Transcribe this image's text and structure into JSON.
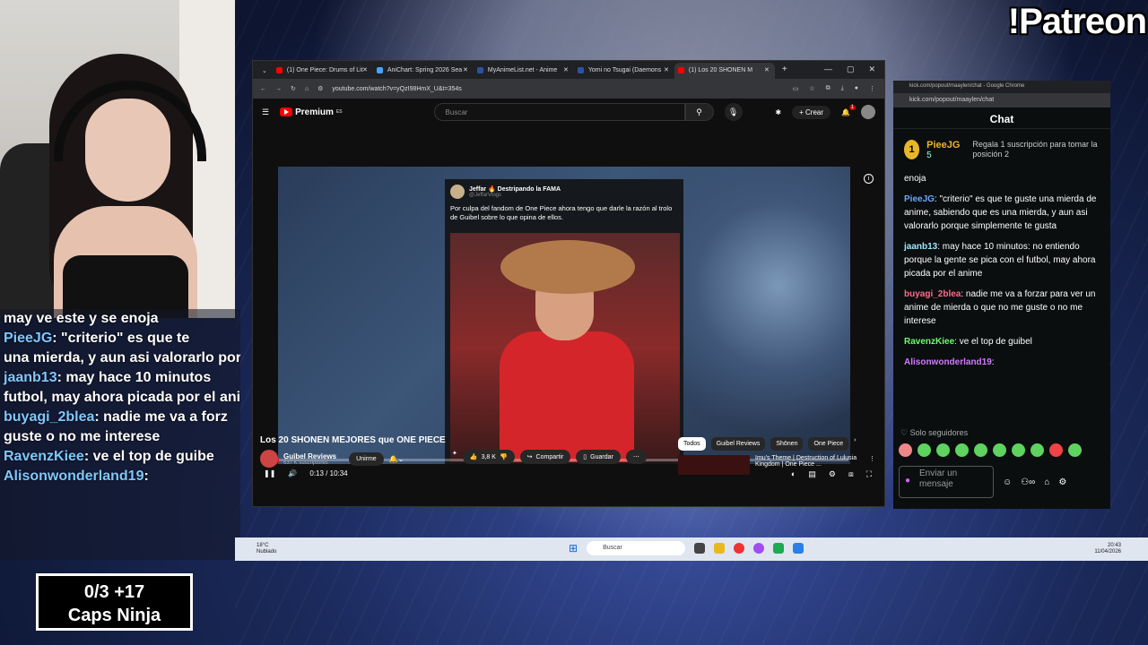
{
  "overlay": {
    "patreon": "!Patreon",
    "caps_line1": "0/3   +17",
    "caps_line2": "Caps Ninja",
    "chat": [
      {
        "user": "",
        "text": "may ve este y se enoja"
      },
      {
        "user": "PieeJG",
        "text": ": \"criterio\" es que te"
      },
      {
        "user": "",
        "text": "una mierda, y aun asi valorarlo por"
      },
      {
        "user": "jaanb13",
        "text": ": may hace 10 minutos"
      },
      {
        "user": "",
        "text": "futbol, may ahora picada por el ani"
      },
      {
        "user": "buyagi_2blea",
        "text": ": nadie me va a forz"
      },
      {
        "user": "",
        "text": "guste o no me interese"
      },
      {
        "user": "RavenzKiee",
        "text": ": ve el top de guibe"
      },
      {
        "user": "Alisonwonderland19",
        "text": ":"
      }
    ]
  },
  "browser": {
    "tabs": [
      {
        "label": "(1) One Piece: Drums of Lit",
        "color": "#ff0000"
      },
      {
        "label": "AniChart: Spring 2026 Sea",
        "color": "#4aa3ff"
      },
      {
        "label": "MyAnimeList.net - Anime",
        "color": "#2e51a2"
      },
      {
        "label": "Yomi no Tsugai (Daemons",
        "color": "#2e51a2"
      },
      {
        "label": "(1) Los 20 SHONEN M",
        "color": "#ff0000"
      }
    ],
    "url": "youtube.com/watch?v=yQzI98HmX_U&t=354s"
  },
  "youtube": {
    "brand": "Premium",
    "region": "ES",
    "search_placeholder": "Buscar",
    "create_label": "Crear",
    "notif_count": "1",
    "tweet": {
      "author": "Jeffar 🔥 Destripando la FAMA",
      "handle": "@JeffarVlogs",
      "text": "Por culpa del fandom de One Piece ahora tengo que darle la razón al trolo de Guibel sobre lo que opina de ellos."
    },
    "time": "0:13 / 10:34",
    "progress_fraction": 0.02,
    "title": "Los 20 SHONEN MEJORES que ONE PIECE",
    "channel": "Guibel Reviews",
    "subs": "637 K suscriptores",
    "join_label": "Unirme",
    "likes": "3,8 K",
    "share_label": "Compartir",
    "save_label": "Guardar",
    "chips": [
      "Todos",
      "Guibel Reviews",
      "Shōnen",
      "One Piece"
    ],
    "rec_title": "Imu's Theme | Destruction of Lulusia Kingdom | One Piece ..."
  },
  "kick": {
    "titlebar": "kick.com/popout/maaylen/chat - Google Chrome",
    "url": "kick.com/popout/maaylen/chat",
    "header": "Chat",
    "gifter": "PieeJG",
    "gift_count": "5",
    "gift_text": "Regala 1 suscripción para tomar la posición 2",
    "top_fragment": "enoja",
    "messages": [
      {
        "user": "PieeJG",
        "cls": "u1",
        "text": ": \"criterio\" es que te guste una mierda de anime, sabiendo que es una mierda, y aun asi valorarlo porque simplemente te gusta"
      },
      {
        "user": "jaanb13",
        "cls": "u2",
        "text": ": may hace 10 minutos: no entiendo porque la gente se pica con el futbol, may ahora picada por el anime"
      },
      {
        "user": "buyagi_2blea",
        "cls": "u3",
        "text": ": nadie me va a forzar para ver un anime de mierda o que no me guste o no me interese"
      },
      {
        "user": "RavenzKiee",
        "cls": "u4",
        "text": ": ve el top de guibel"
      },
      {
        "user": "Alisonwonderland19",
        "cls": "u5",
        "text": ":"
      }
    ],
    "followers_only": "Solo seguidores",
    "input_placeholder": "Enviar un mensaje"
  },
  "taskbar": {
    "weather_temp": "18°C",
    "weather_desc": "Nublado",
    "search_placeholder": "Buscar",
    "time": "20:43",
    "date": "11/04/2026"
  }
}
